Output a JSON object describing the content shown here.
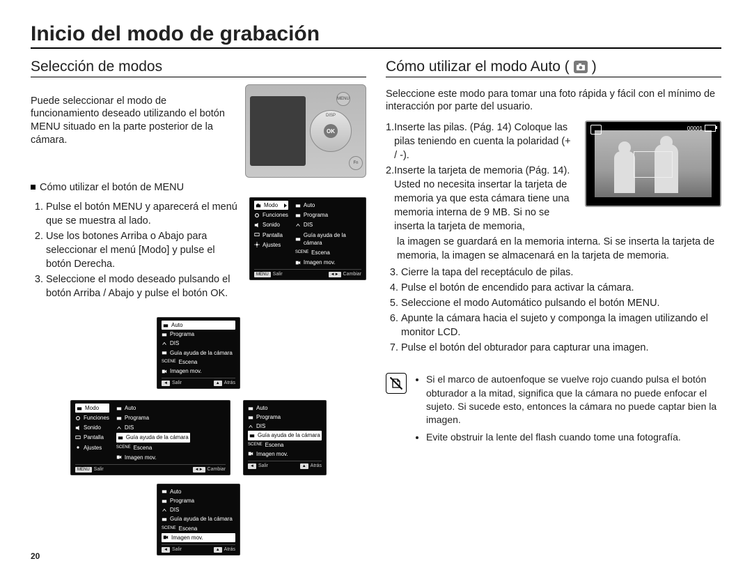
{
  "page_title": "Inicio del modo de grabación",
  "page_number": "20",
  "left": {
    "heading": "Selección de modos",
    "intro": "Puede seleccionar el modo de funcionamiento deseado utilizando el botón MENU situado en la parte posterior de la cámara.",
    "sub_heading": "Cómo utilizar el botón de MENU",
    "steps": [
      "Pulse el botón MENU y aparecerá el menú que se muestra al lado.",
      "Use los botones Arriba o Abajo para seleccionar el menú [Modo] y pulse el botón Derecha.",
      "Seleccione el modo deseado pulsando el botón Arriba / Abajo y pulse el botón OK."
    ],
    "dpad": {
      "ok": "OK",
      "n": "DISP",
      "s": "",
      "w": "",
      "e": ""
    },
    "cam_buttons": {
      "m1": "MENU",
      "m2": "Fn",
      "m3": ""
    },
    "osd": {
      "left_menu": [
        "Modo",
        "Funciones",
        "Sonido",
        "Pantalla",
        "Ajustes"
      ],
      "right_menu": [
        "Auto",
        "Programa",
        "DIS",
        "Guía ayuda de la cámara",
        "Escena",
        "Imagen mov."
      ],
      "right_menu_scene": "Escena",
      "exit_key": "MENU",
      "exit_lbl": "Salir",
      "move_key": "◄►",
      "move_lbl": "Cambiar",
      "back_lbl": "Atrás",
      "back_key": "◄",
      "sel_mode": "Modo",
      "sel_auto": "Auto"
    }
  },
  "right": {
    "heading": "Cómo utilizar el modo Auto (",
    "heading_close": ")",
    "intro": "Seleccione este modo para tomar una foto rápida y fácil con el mínimo de interacción por parte del usuario.",
    "lcd": {
      "counter": "00001"
    },
    "step1a": "Inserte las pilas. (Pág. 14) Coloque las pilas teniendo en cuenta la polaridad (+ / -).",
    "step2a": "Inserte la tarjeta de memoria (Pág. 14). Usted no necesita insertar la tarjeta de memoria ya que esta cámara tiene una memoria interna de 9 MB. Si no se inserta la tarjeta de memoria,",
    "step2b": "la imagen se guardará en la memoria interna. Si se inserta la tarjeta de memoria, la imagen se almacenará en la tarjeta de memoria.",
    "steps_rest": [
      "Cierre la tapa del receptáculo de pilas.",
      "Pulse el botón de encendido para activar la cámara.",
      "Seleccione el modo Automático pulsando el botón MENU.",
      "Apunte la cámara hacia el sujeto y componga la imagen utilizando el monitor LCD.",
      "Pulse el botón del obturador para capturar una imagen."
    ],
    "notes": [
      "Si el marco de autoenfoque se vuelve rojo cuando pulsa el botón obturador a la mitad, significa que la cámara no puede enfocar el sujeto. Si sucede esto, entonces la cámara no puede captar bien la imagen.",
      "Evite obstruir la lente del flash cuando tome una fotografía."
    ]
  }
}
